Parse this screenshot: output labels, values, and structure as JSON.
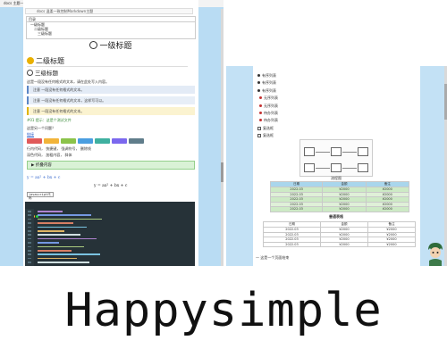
{
  "left_screenshot": {
    "topbar_text": "docs 主题一致 Writings 阅读 Markdown 渲染",
    "address_text": "docs 温柔一致控制Markdown主题",
    "toc": {
      "header": "目录",
      "items": [
        "一级标题",
        "二级标题",
        "三级标题"
      ]
    },
    "h1": "一级标题",
    "h2": "二级标题",
    "h3": "三级标题",
    "paragraph": "这是一段没有任何格式的文本，请在此处写入内容。",
    "callouts": [
      "注意 一段没有任何格式的文本。",
      "注意 一段没有任何格式的文本，这样写可以。",
      "注意 一段没有任何格式的文本。"
    ],
    "link_line": "#01 提示：这是个测试文件",
    "question_line": "这是另一个问题？",
    "link_text": "链接",
    "tag_colors": [
      "#e05a5a",
      "#f2b43a",
      "#8bc34a",
      "#4a9ee0",
      "#3fb0a0",
      "#7b68ee",
      "#607d8b"
    ],
    "inline_row1": "行内代码， 快捷键， 强调符号， 删除线",
    "inline_row2": "深色代码， 加粗内容， 斜体",
    "summary_text": "▶ 折叠内容",
    "formula_inline": "y = ax² + bx + c",
    "formula_block": "y = ax² + bx + c",
    "code_button": "javascript代码",
    "code_dot_colors": [
      "#ff5f56",
      "#ffbd2e",
      "#27c93f"
    ]
  },
  "right_screenshot": {
    "list_items": [
      {
        "text": "有序列表",
        "style": "bullet"
      },
      {
        "text": "有序列表",
        "style": "bullet"
      },
      {
        "text": "有序列表",
        "style": "bullet"
      },
      {
        "text": "无序列表",
        "style": "red"
      },
      {
        "text": "无序列表",
        "style": "red"
      },
      {
        "text": "待办列表",
        "style": "red"
      },
      {
        "text": "待办列表",
        "style": "red"
      },
      {
        "text": "复选框",
        "style": "checkbox"
      },
      {
        "text": "复选框",
        "style": "checkbox"
      }
    ],
    "diagram_caption": "流程图",
    "table1": {
      "headers": [
        "日期",
        "金额",
        "备注"
      ],
      "rows": [
        [
          "2022.03",
          "¥2000",
          "¥2000"
        ],
        [
          "2022.03",
          "¥2000",
          "¥2000"
        ],
        [
          "2022.03",
          "¥2000",
          "¥2000"
        ],
        [
          "2022.03",
          "¥2000",
          "¥2000"
        ],
        [
          "2022.03",
          "¥2000",
          "¥2000"
        ]
      ]
    },
    "table2_caption": "普通表格",
    "table2": {
      "headers": [
        "日期",
        "金额",
        "备注"
      ],
      "rows": [
        [
          "2022.03",
          "¥2000",
          "¥2000"
        ],
        [
          "2022.03",
          "¥2000",
          "¥2000"
        ],
        [
          "2022.03",
          "¥2000",
          "¥2000"
        ],
        [
          "2022.03",
          "¥2000",
          "¥2000"
        ]
      ]
    },
    "footer_text": "一 这是一个页面结束"
  },
  "title": "Happysimple"
}
